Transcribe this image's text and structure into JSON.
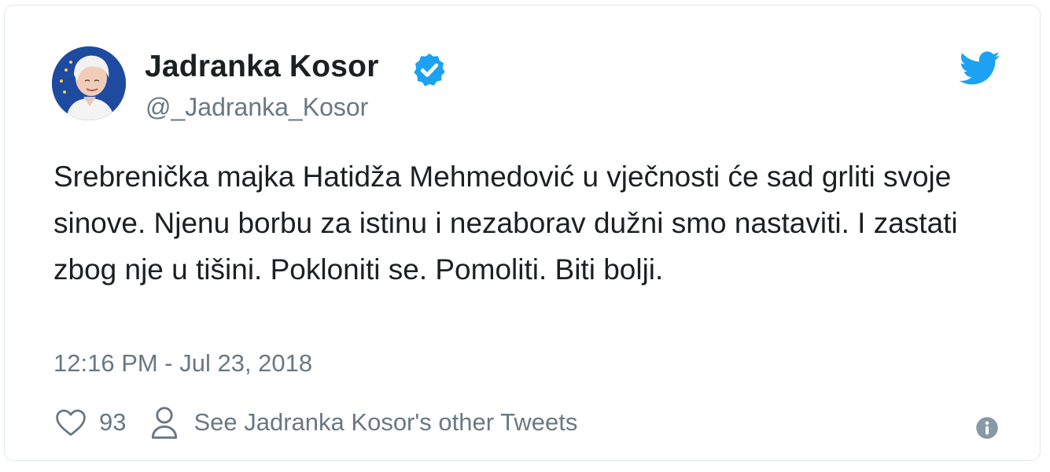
{
  "tweet": {
    "author_name": "Jadranka Kosor",
    "author_handle": "@_Jadranka_Kosor",
    "text": "Srebrenička majka Hatidža Mehmedović u vječnosti će sad grliti svoje sinove. Njenu borbu za istinu i nezaborav dužni smo nastaviti. I zastati zbog nje u tišini. Pokloniti se. Pomoliti. Biti bolji.",
    "timestamp": "12:16 PM - Jul 23, 2018",
    "like_count": "93",
    "profile_link_label": "See Jadranka Kosor's other Tweets"
  },
  "icons": {
    "verified": "verified-badge-icon",
    "brand": "twitter-bird-icon",
    "like": "heart-icon",
    "profile": "person-icon",
    "info": "info-icon"
  },
  "colors": {
    "brand_blue": "#1da1f2",
    "text_primary": "#1c2022",
    "text_secondary": "#697882",
    "border": "#e1e8ed"
  }
}
